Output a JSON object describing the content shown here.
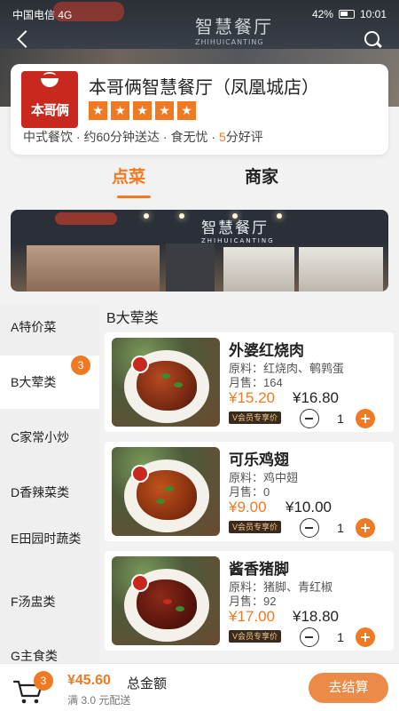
{
  "status_bar": {
    "carrier": "中国电信 4G",
    "battery": "42%",
    "time": "10:01"
  },
  "store": {
    "logo_text": "本哥俩",
    "name": "本哥俩智慧餐厅（凤凰城店）",
    "rating_stars": 5,
    "cuisine": "中式餐饮",
    "delivery_time": "约60分钟送达",
    "tagline": "食无忧",
    "score_value": "5",
    "score_suffix": "分好评",
    "sign_text": "智慧餐厅",
    "sign_sub": "ZHIHUICANTING"
  },
  "tabs": [
    {
      "label": "点菜",
      "active": true
    },
    {
      "label": "商家",
      "active": false
    }
  ],
  "categories": [
    {
      "label": "A特价菜"
    },
    {
      "label": "B大荤类",
      "badge": "3",
      "active": true
    },
    {
      "label": "C家常小炒"
    },
    {
      "label": "D香辣菜类"
    },
    {
      "label": "E田园时蔬类"
    },
    {
      "label": "F汤盅类"
    },
    {
      "label": "G主食类"
    }
  ],
  "section_title": "B大荤类",
  "dishes": [
    {
      "name": "外婆红烧肉",
      "ingredients_label": "原料：",
      "ingredients": "红烧肉、鹌鹑蛋",
      "sold_label": "月售：",
      "sold": "164",
      "price": "¥15.20",
      "member_price": "¥16.80",
      "vip_tag": "会员专享价",
      "qty": "1"
    },
    {
      "name": "可乐鸡翅",
      "ingredients_label": "原料：",
      "ingredients": "鸡中翅",
      "sold_label": "月售：",
      "sold": "0",
      "price": "¥9.00",
      "member_price": "¥10.00",
      "vip_tag": "会员专享价",
      "qty": "1"
    },
    {
      "name": "酱香猪脚",
      "ingredients_label": "原料：",
      "ingredients": "猪脚、青红椒",
      "sold_label": "月售：",
      "sold": "92",
      "price": "¥17.00",
      "member_price": "¥18.80",
      "vip_tag": "会员专享价",
      "qty": "1"
    }
  ],
  "cart": {
    "count": "3",
    "total": "¥45.60",
    "total_label": "总金额",
    "delivery_note": "满 3.0 元配送",
    "checkout_label": "去结算"
  },
  "colors": {
    "accent": "#f07a24",
    "checkout": "#ec8a48",
    "logo_red": "#c8281e"
  }
}
